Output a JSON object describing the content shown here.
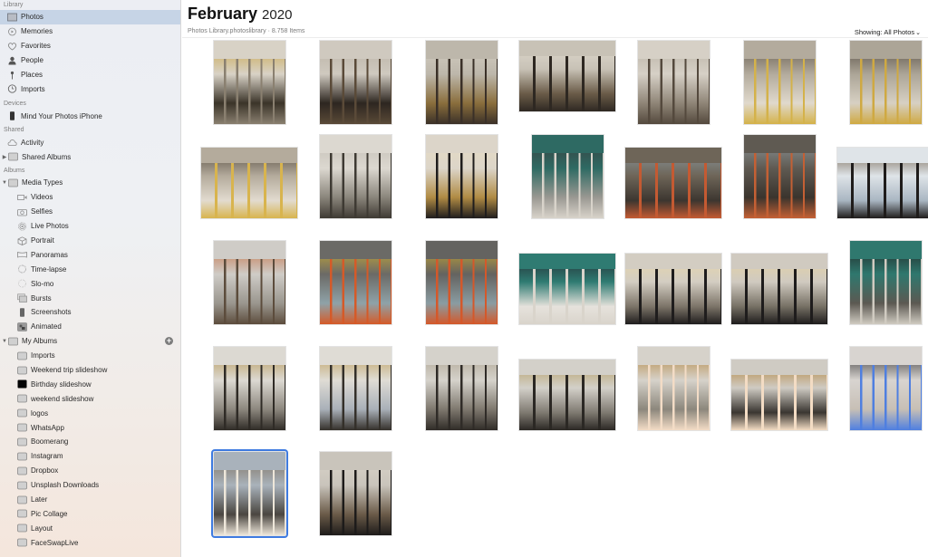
{
  "sidebar": {
    "sections": {
      "library": "Library",
      "devices": "Devices",
      "shared": "Shared",
      "albums": "Albums"
    },
    "library_items": [
      {
        "label": "Photos",
        "icon": "photos-icon",
        "selected": true
      },
      {
        "label": "Memories",
        "icon": "memories-icon"
      },
      {
        "label": "Favorites",
        "icon": "heart-icon"
      },
      {
        "label": "People",
        "icon": "person-icon"
      },
      {
        "label": "Places",
        "icon": "pin-icon"
      },
      {
        "label": "Imports",
        "icon": "clock-icon"
      }
    ],
    "device_items": [
      {
        "label": "Mind Your Photos iPhone",
        "icon": "iphone-icon"
      }
    ],
    "shared_items": [
      {
        "label": "Activity",
        "icon": "cloud-icon"
      },
      {
        "label": "Shared Albums",
        "icon": "folder-icon",
        "disclosure": "collapsed"
      }
    ],
    "media_types": {
      "label": "Media Types",
      "disclosure": "expanded",
      "items": [
        {
          "label": "Videos",
          "icon": "video-icon"
        },
        {
          "label": "Selfies",
          "icon": "camera-icon"
        },
        {
          "label": "Live Photos",
          "icon": "live-photo-icon"
        },
        {
          "label": "Portrait",
          "icon": "cube-icon"
        },
        {
          "label": "Panoramas",
          "icon": "panorama-icon"
        },
        {
          "label": "Time-lapse",
          "icon": "timelapse-icon"
        },
        {
          "label": "Slo-mo",
          "icon": "slomo-icon"
        },
        {
          "label": "Bursts",
          "icon": "bursts-icon"
        },
        {
          "label": "Screenshots",
          "icon": "screenshot-icon"
        },
        {
          "label": "Animated",
          "icon": "animated-icon"
        }
      ]
    },
    "my_albums": {
      "label": "My Albums",
      "disclosure": "expanded",
      "add_label": "+",
      "items": [
        {
          "label": "Imports"
        },
        {
          "label": "Weekend trip slideshow"
        },
        {
          "label": "Birthday slideshow",
          "dark_thumb": true
        },
        {
          "label": "weekend slideshow"
        },
        {
          "label": "logos"
        },
        {
          "label": "WhatsApp"
        },
        {
          "label": "Boomerang"
        },
        {
          "label": "Instagram"
        },
        {
          "label": "Dropbox"
        },
        {
          "label": "Unsplash Downloads"
        },
        {
          "label": "Later"
        },
        {
          "label": "Pic Collage"
        },
        {
          "label": "Layout"
        },
        {
          "label": "FaceSwapLive"
        }
      ]
    }
  },
  "header": {
    "month": "February",
    "year": "2020",
    "subtitle": "Photos Library.photoslibrary · 8.758 Items",
    "showing_label": "Showing: All Photos",
    "showing_chevron": "⌄"
  },
  "colors": {
    "selection_highlight": "#c6d4e6",
    "selected_photo_border": "#3f7be0"
  },
  "photos": [
    {
      "desc": "gold railing atrium",
      "orientation": "portrait",
      "palette": [
        "#d8d2c6",
        "#8a8070",
        "#c9a340",
        "#3b3429"
      ]
    },
    {
      "desc": "staircase",
      "orientation": "portrait",
      "palette": [
        "#cfc9bf",
        "#5a4a38",
        "#b8b0a3",
        "#2d2620"
      ]
    },
    {
      "desc": "elevator shaft ironwork",
      "orientation": "portrait",
      "palette": [
        "#bdb7ab",
        "#3a3028",
        "#d5cfc3",
        "#8a6e3c"
      ]
    },
    {
      "desc": "elevator ironwork landscape",
      "orientation": "landscape",
      "palette": [
        "#c8c2b6",
        "#2e2822",
        "#e1dbd0",
        "#6a5b48"
      ]
    },
    {
      "desc": "balcony stairs",
      "orientation": "portrait",
      "palette": [
        "#d6d0c6",
        "#54493d",
        "#b7afa2",
        "#8f8577"
      ]
    },
    {
      "desc": "golden elevator door",
      "orientation": "portrait",
      "palette": [
        "#b3ab9d",
        "#d4b24a",
        "#5b5144",
        "#e0d9cc"
      ]
    },
    {
      "desc": "golden elevator door 2",
      "orientation": "portrait",
      "palette": [
        "#aca597",
        "#cfa942",
        "#4d443a",
        "#d7d0c3"
      ]
    },
    {
      "desc": "golden elevator landscape",
      "orientation": "landscape",
      "palette": [
        "#b4ab9c",
        "#d8b44e",
        "#4f463b",
        "#e2dbcf"
      ]
    },
    {
      "desc": "atrium balconies",
      "orientation": "portrait",
      "palette": [
        "#dcd8d0",
        "#3e3a33",
        "#c0bbb2",
        "#8a857b"
      ]
    },
    {
      "desc": "pendant lamp clothing",
      "orientation": "portrait",
      "palette": [
        "#dcd5c9",
        "#1f1d1d",
        "#e8dcc1",
        "#b08b44"
      ]
    },
    {
      "desc": "store interior mannequin",
      "orientation": "portrait",
      "palette": [
        "#2e6a63",
        "#d8d3ca",
        "#3b3a3b",
        "#9a9892"
      ]
    },
    {
      "desc": "cafe hall",
      "orientation": "landscape",
      "palette": [
        "#6e6558",
        "#c45a32",
        "#8c9aa0",
        "#3c3630"
      ]
    },
    {
      "desc": "cafe hall 2",
      "orientation": "portrait",
      "palette": [
        "#5f5a52",
        "#c46034",
        "#949ea2",
        "#3a342d"
      ]
    },
    {
      "desc": "window clothing rack",
      "orientation": "landscape",
      "palette": [
        "#dfe4e8",
        "#1f1c1b",
        "#6b5a45",
        "#a9b6c2"
      ]
    },
    {
      "desc": "glass tubes",
      "orientation": "portrait",
      "palette": [
        "#cfccc7",
        "#5c4c3c",
        "#c46a3a",
        "#9a968e"
      ]
    },
    {
      "desc": "orange yellow columns",
      "orientation": "portrait",
      "palette": [
        "#6b6a66",
        "#d55a28",
        "#d8b42e",
        "#8fa2a8"
      ]
    },
    {
      "desc": "orange yellow columns 2",
      "orientation": "portrait",
      "palette": [
        "#646360",
        "#d4582a",
        "#d6b02c",
        "#8a9ca2"
      ]
    },
    {
      "desc": "store teal ceiling",
      "orientation": "landscape",
      "palette": [
        "#2f7b72",
        "#d9d4cb",
        "#23262d",
        "#e6e2dc"
      ]
    },
    {
      "desc": "mannequin lamp",
      "orientation": "landscape",
      "palette": [
        "#d3cdc2",
        "#1f1d1d",
        "#e9d7a8",
        "#7c7468"
      ]
    },
    {
      "desc": "mannequin lamp 2",
      "orientation": "landscape",
      "palette": [
        "#d0cac0",
        "#1e1c1c",
        "#e6d3a2",
        "#767064"
      ]
    },
    {
      "desc": "mannequin teal",
      "orientation": "portrait",
      "palette": [
        "#2f786e",
        "#d0cbc1",
        "#1f1d1d",
        "#5c5952"
      ]
    },
    {
      "desc": "atrium gold railing",
      "orientation": "portrait",
      "palette": [
        "#dcd9d2",
        "#2f2b26",
        "#b08d44",
        "#8c877e"
      ]
    },
    {
      "desc": "atrium skylight railing",
      "orientation": "portrait",
      "palette": [
        "#dfdcd5",
        "#34302a",
        "#b89548",
        "#a9b0b8"
      ]
    },
    {
      "desc": "atrium floors",
      "orientation": "portrait",
      "palette": [
        "#d5d2cb",
        "#2f2b27",
        "#a69b86",
        "#7e786e"
      ]
    },
    {
      "desc": "atrium floors landscape",
      "orientation": "landscape",
      "palette": [
        "#d3d0c9",
        "#2b2824",
        "#b39a5c",
        "#7f7a71"
      ]
    },
    {
      "desc": "big pendant lamp",
      "orientation": "portrait",
      "palette": [
        "#d6d2ca",
        "#f3dcc6",
        "#b07d2e",
        "#8c877c"
      ]
    },
    {
      "desc": "pendant lamp skylight",
      "orientation": "landscape",
      "palette": [
        "#cfcbc3",
        "#f3dcc4",
        "#b27f30",
        "#3a3631"
      ]
    },
    {
      "desc": "blue light mannequins",
      "orientation": "portrait",
      "palette": [
        "#d8d4d0",
        "#4f7fe0",
        "#1f1d1f",
        "#c7bfb5"
      ]
    },
    {
      "desc": "lamp skylight selected",
      "orientation": "portrait",
      "palette": [
        "#a9b2bb",
        "#eee7da",
        "#7a6a55",
        "#4a4640"
      ],
      "selected": true
    },
    {
      "desc": "elevator view stairs",
      "orientation": "portrait",
      "palette": [
        "#c9c4bb",
        "#1d1b1a",
        "#dcd6cb",
        "#6a5a48"
      ]
    }
  ]
}
